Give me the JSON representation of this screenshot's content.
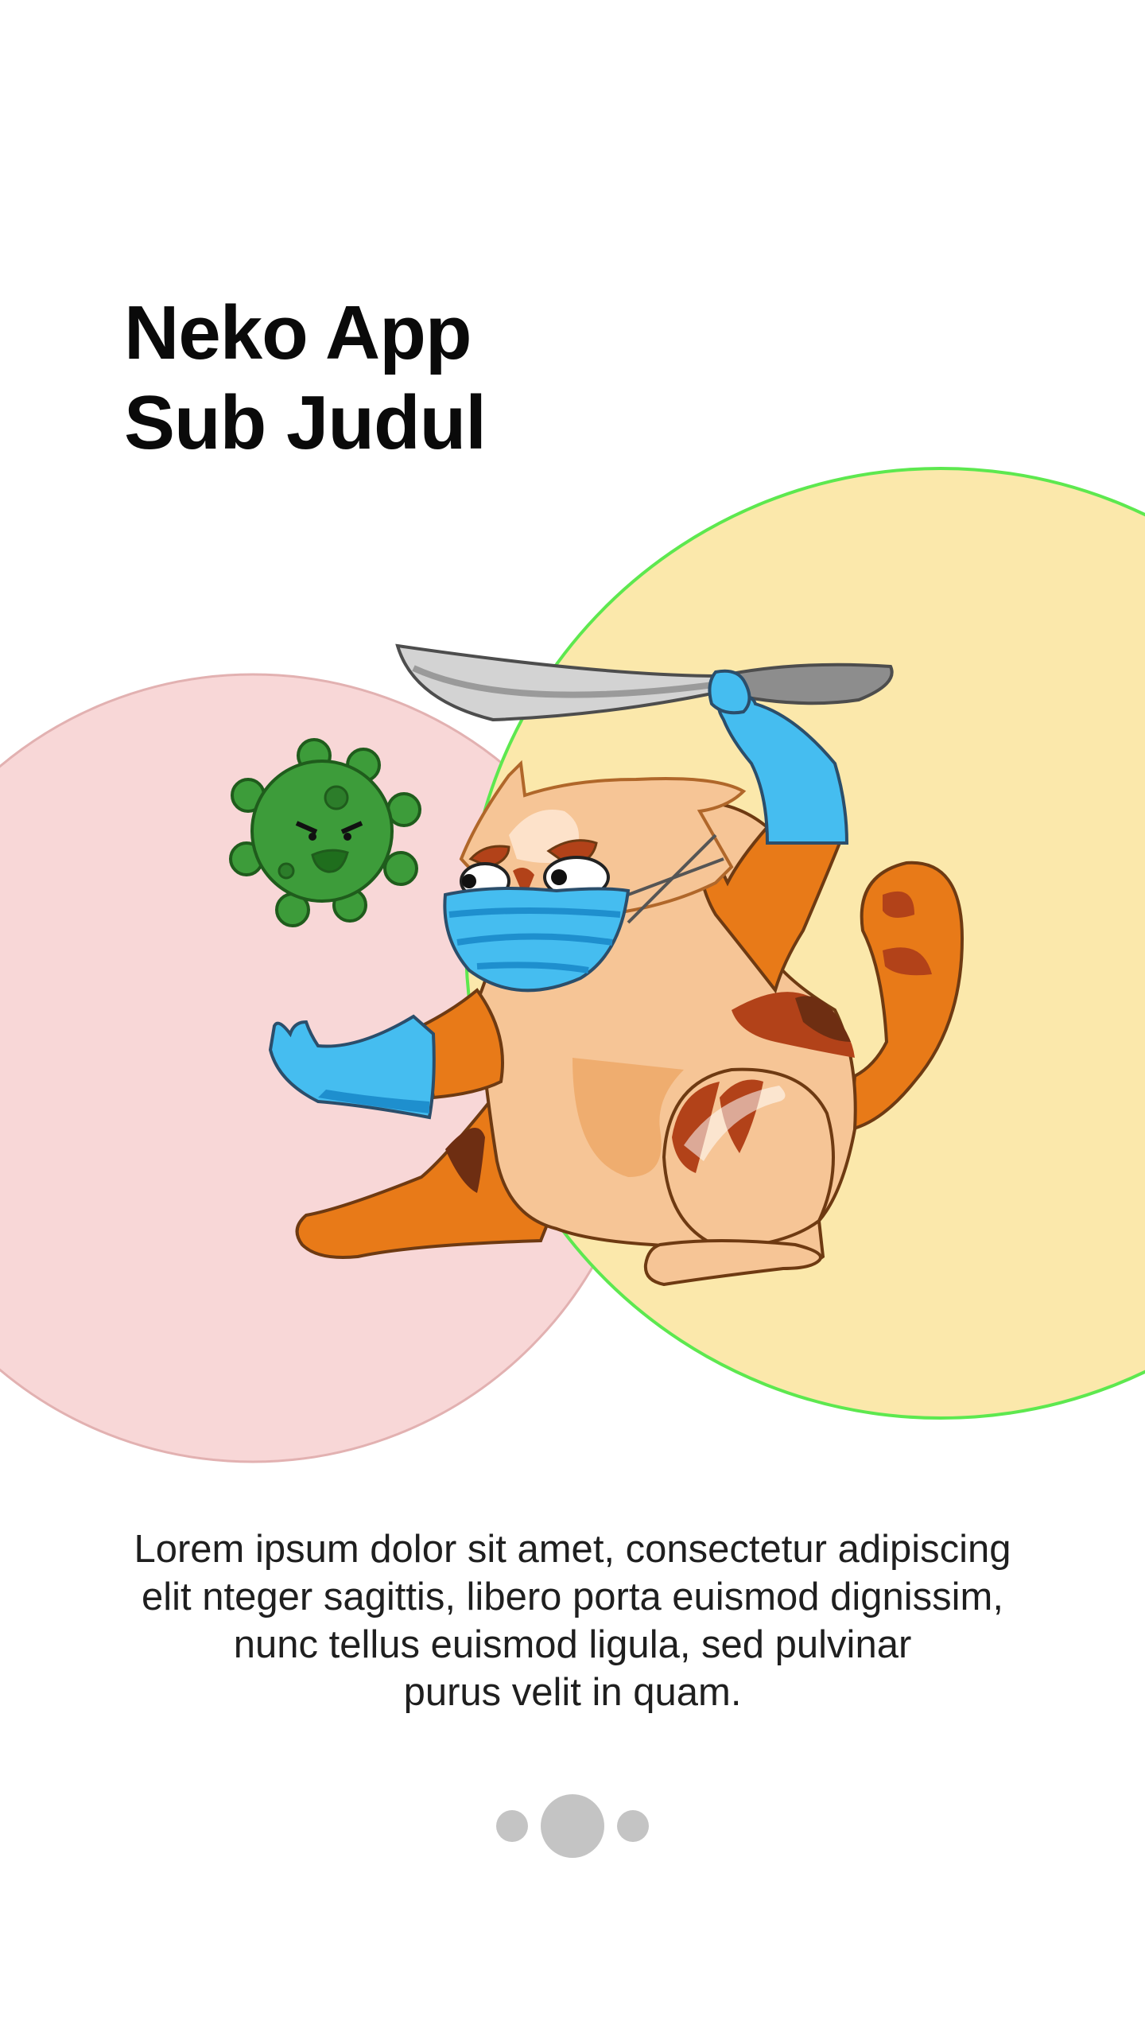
{
  "header": {
    "title_line1": "Neko App",
    "title_line2": "Sub Judul"
  },
  "illustration": {
    "subject": "cat-with-mask-and-sword-icon",
    "virus": "virus-icon",
    "colors": {
      "pink_circle_fill": "#f8d7d7",
      "pink_circle_stroke": "#e2b1b1",
      "yellow_circle_fill": "#fbe8ab",
      "yellow_circle_stroke": "#5de84f",
      "cat_orange": "#e87a18",
      "cat_body": "#f6c596",
      "mask_blue": "#45bdf0",
      "virus_green": "#3d9c3a"
    }
  },
  "description": {
    "line1": "Lorem ipsum dolor sit amet, consectetur adipiscing",
    "line2": "elit nteger sagittis, libero porta euismod dignissim,",
    "line3": "nunc tellus euismod ligula, sed pulvinar",
    "line4": "purus velit in quam."
  },
  "pagination": {
    "total": 3,
    "active_index": 1
  }
}
